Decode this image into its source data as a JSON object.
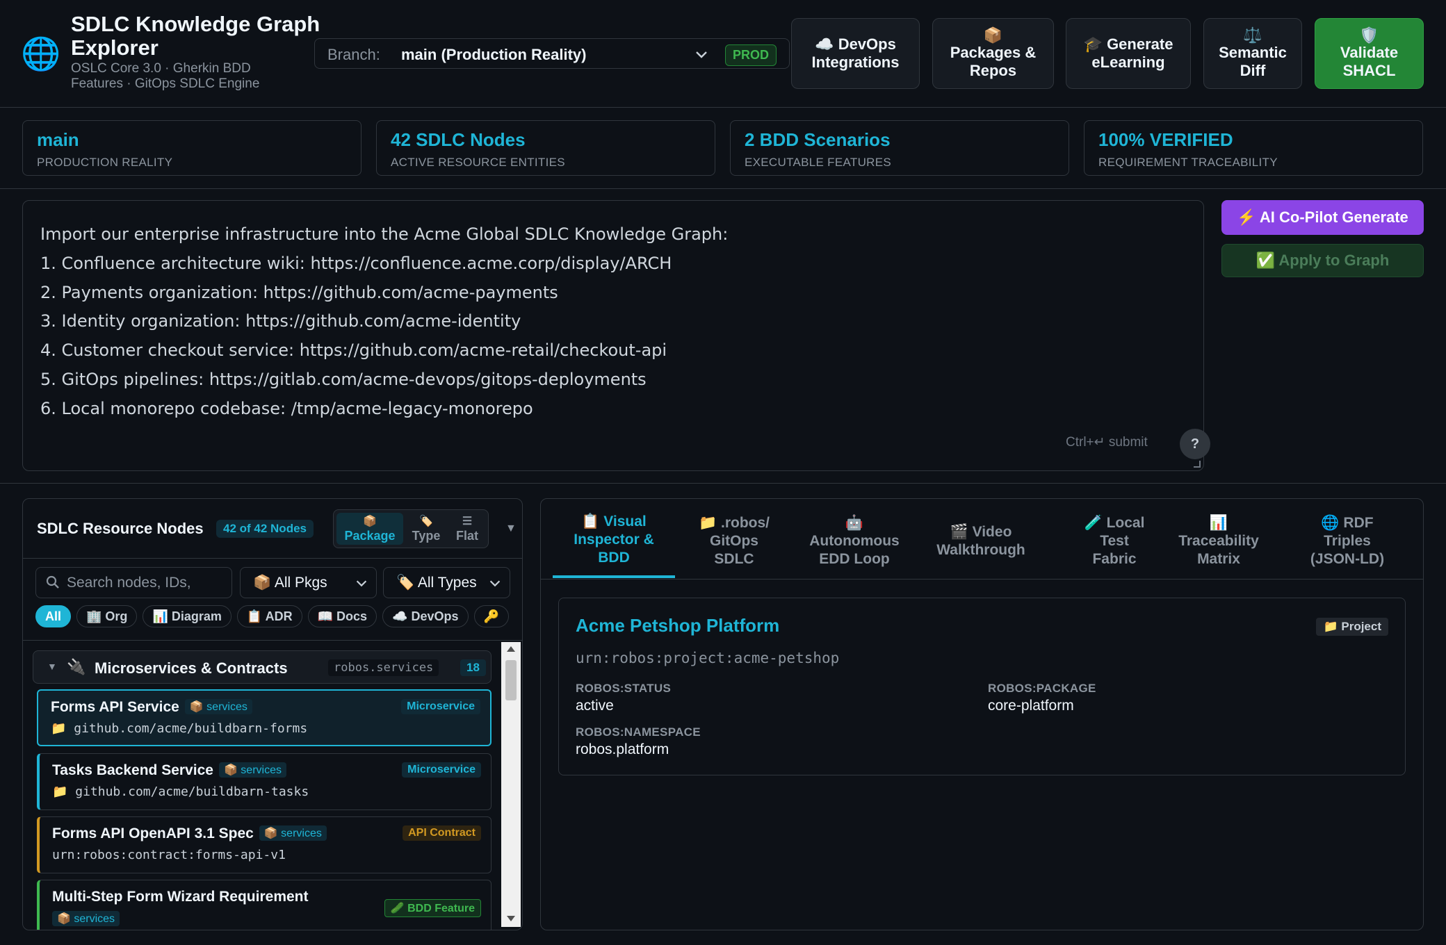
{
  "app": {
    "title": "SDLC Knowledge Graph Explorer",
    "subtitle": "OSLC Core 3.0 · Gherkin BDD Features · GitOps SDLC Engine"
  },
  "branch": {
    "label": "Branch:",
    "value": "main (Production Reality)",
    "env_badge": "PROD"
  },
  "header_buttons": [
    {
      "icon": "☁️",
      "label": "DevOps Integrations"
    },
    {
      "icon": "📦",
      "label": "Packages & Repos"
    },
    {
      "icon": "🎓",
      "label": "Generate eLearning"
    },
    {
      "icon": "⚖️",
      "label": "Semantic Diff"
    },
    {
      "icon": "🛡️",
      "label": "Validate SHACL"
    }
  ],
  "stats": [
    {
      "value": "main",
      "label": "PRODUCTION REALITY"
    },
    {
      "value": "42 SDLC Nodes",
      "label": "ACTIVE RESOURCE ENTITIES"
    },
    {
      "value": "2 BDD Scenarios",
      "label": "EXECUTABLE FEATURES"
    },
    {
      "value": "100% VERIFIED",
      "label": "REQUIREMENT TRACEABILITY"
    }
  ],
  "prompt": {
    "lines": [
      "Import our enterprise infrastructure into the Acme Global SDLC Knowledge Graph:",
      "1. Confluence architecture wiki: https://confluence.acme.corp/display/ARCH",
      "2. Payments organization: https://github.com/acme-payments",
      "3. Identity organization: https://github.com/acme-identity",
      "4. Customer checkout service: https://github.com/acme-retail/checkout-api",
      "5. GitOps pipelines: https://gitlab.com/acme-devops/gitops-deployments",
      "6. Local monorepo codebase: /tmp/acme-legacy-monorepo"
    ],
    "hint": "Ctrl+↵ submit",
    "help": "?"
  },
  "actions": {
    "ai_generate": "⚡ AI Co-Pilot Generate",
    "apply": "✅ Apply to Graph"
  },
  "nodes_panel": {
    "title": "SDLC Resource Nodes",
    "count": "42 of 42 Nodes",
    "views": [
      {
        "icon": "📦",
        "label": "Package"
      },
      {
        "icon": "🏷️",
        "label": "Type"
      },
      {
        "icon": "☰",
        "label": "Flat"
      }
    ],
    "search_placeholder": "Search nodes, IDs,",
    "pkg_filter": "📦 All Pkgs",
    "type_filter": "🏷️ All Types",
    "chips": [
      "All",
      "🏢 Org",
      "📊 Diagram",
      "📋 ADR",
      "📖 Docs",
      "☁️ DevOps",
      "🔑"
    ],
    "group": {
      "title": "Microservices & Contracts",
      "namespace": "robos.services",
      "count": "18"
    },
    "items": [
      {
        "title": "Forms API Service",
        "pkg": "📦 services",
        "path": "📁 github.com/acme/buildbarn-forms",
        "type": "Microservice"
      },
      {
        "title": "Tasks Backend Service",
        "pkg": "📦 services",
        "path": "📁 github.com/acme/buildbarn-tasks",
        "type": "Microservice"
      },
      {
        "title": "Forms API OpenAPI 3.1 Spec",
        "pkg": "📦 services",
        "path": "urn:robos:contract:forms-api-v1",
        "type": "API Contract"
      },
      {
        "title": "Multi-Step Form Wizard Requirement",
        "pkg": "📦 services",
        "type": "🥒 BDD Feature"
      }
    ]
  },
  "tabs": [
    {
      "icon": "📋",
      "label": "Visual Inspector & BDD"
    },
    {
      "icon": "📁",
      "label": ".robos/ GitOps SDLC"
    },
    {
      "icon": "🤖",
      "label": "Autonomous EDD Loop"
    },
    {
      "icon": "🎬",
      "label": "Video Walkthrough"
    },
    {
      "icon": "🧪",
      "label": "Local Test Fabric"
    },
    {
      "icon": "📊",
      "label": "Traceability Matrix"
    },
    {
      "icon": "🌐",
      "label": "RDF Triples (JSON-LD)"
    }
  ],
  "inspector": {
    "title": "Acme Petshop Platform",
    "type": "📁 Project",
    "urn": "urn:robos:project:acme-petshop",
    "fields": [
      {
        "label": "ROBOS:STATUS",
        "value": "active"
      },
      {
        "label": "ROBOS:PACKAGE",
        "value": "core-platform"
      },
      {
        "label": "ROBOS:NAMESPACE",
        "value": "robos.platform"
      }
    ]
  },
  "colors": {
    "accent": "#1fb5d6",
    "success": "#238636",
    "ai": "#8b45e6",
    "contract": "#d29922",
    "bdd": "#3fb950"
  }
}
